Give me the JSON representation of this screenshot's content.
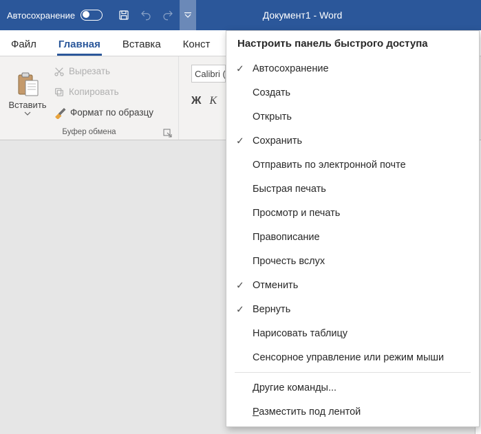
{
  "titlebar": {
    "autosave_label": "Автосохранение",
    "document_title": "Документ1  -  Word"
  },
  "tabs": {
    "file": "Файл",
    "home": "Главная",
    "insert": "Вставка",
    "design": "Конст"
  },
  "ribbon": {
    "paste_label": "Вставить",
    "cut_label": "Вырезать",
    "copy_label": "Копировать",
    "format_painter_label": "Формат по образцу",
    "clipboard_group": "Буфер обмена",
    "font_name": "Calibri (",
    "bold": "Ж",
    "italic": "К"
  },
  "menu": {
    "title": "Настроить панель быстрого доступа",
    "items": [
      {
        "label": "Автосохранение",
        "checked": true
      },
      {
        "label": "Создать",
        "checked": false
      },
      {
        "label": "Открыть",
        "checked": false
      },
      {
        "label": "Сохранить",
        "checked": true
      },
      {
        "label": "Отправить по электронной почте",
        "checked": false
      },
      {
        "label": "Быстрая печать",
        "checked": false
      },
      {
        "label": "Просмотр и печать",
        "checked": false
      },
      {
        "label": "Правописание",
        "checked": false
      },
      {
        "label": "Прочесть вслух",
        "checked": false
      },
      {
        "label": "Отменить",
        "checked": true
      },
      {
        "label": "Вернуть",
        "checked": true
      },
      {
        "label": "Нарисовать таблицу",
        "checked": false
      },
      {
        "label": "Сенсорное управление или режим мыши",
        "checked": false
      }
    ],
    "other_commands": "Другие команды...",
    "below_ribbon": "Разместить под лентой"
  }
}
